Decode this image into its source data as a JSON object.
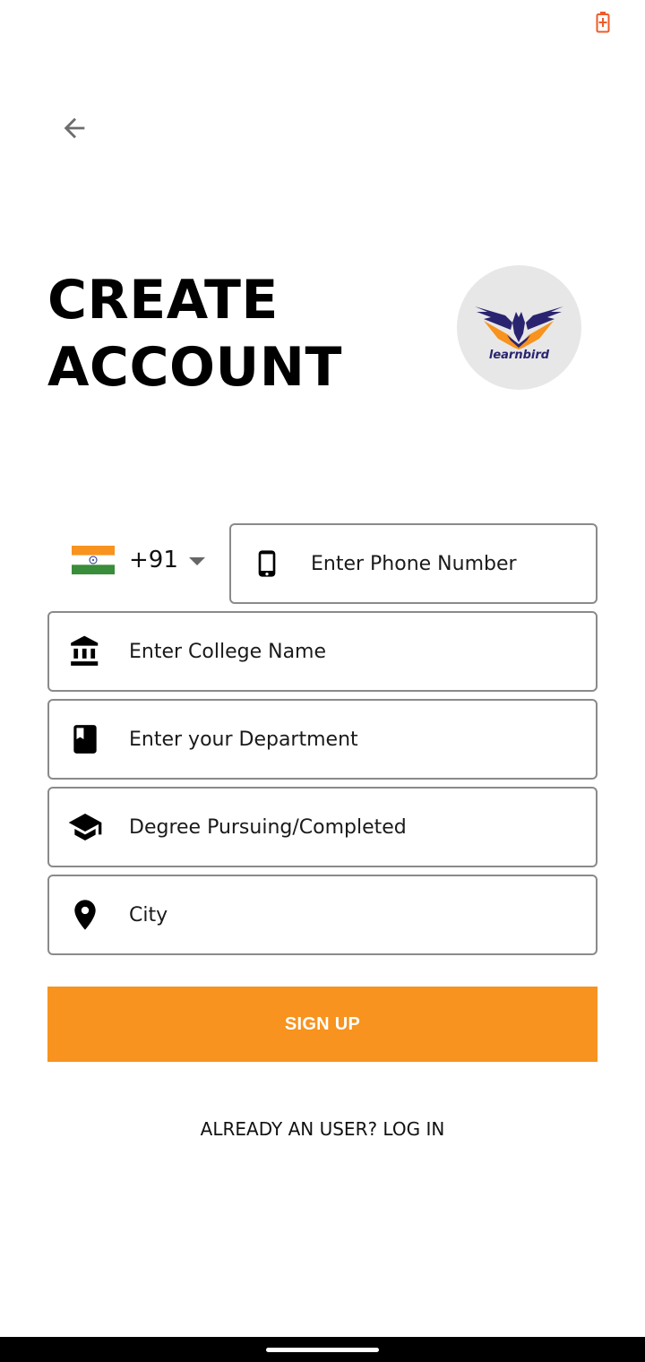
{
  "colors": {
    "accent": "#f7931e",
    "battery": "#f05a28",
    "border": "#8a8a8a",
    "logo_bg": "#e7e7e7",
    "logo_navy": "#2a2470"
  },
  "header": {
    "back_icon": "arrow-left-icon",
    "title_line1": "CREATE",
    "title_line2": "ACCOUNT",
    "logo_text": "learnbird"
  },
  "form": {
    "country_code": "+91",
    "country_flag": "india-flag-icon",
    "phone": {
      "icon": "smartphone-icon",
      "placeholder": "Enter Phone Number",
      "value": ""
    },
    "college": {
      "icon": "institution-icon",
      "placeholder": "Enter College Name",
      "value": ""
    },
    "department": {
      "icon": "book-icon",
      "placeholder": "Enter your Department",
      "value": ""
    },
    "degree": {
      "icon": "graduation-cap-icon",
      "placeholder": "Degree Pursuing/Completed",
      "value": ""
    },
    "city": {
      "icon": "location-pin-icon",
      "placeholder": "City",
      "value": ""
    },
    "signup_label": "SIGN UP",
    "login_label": "ALREADY AN USER? LOG IN"
  }
}
